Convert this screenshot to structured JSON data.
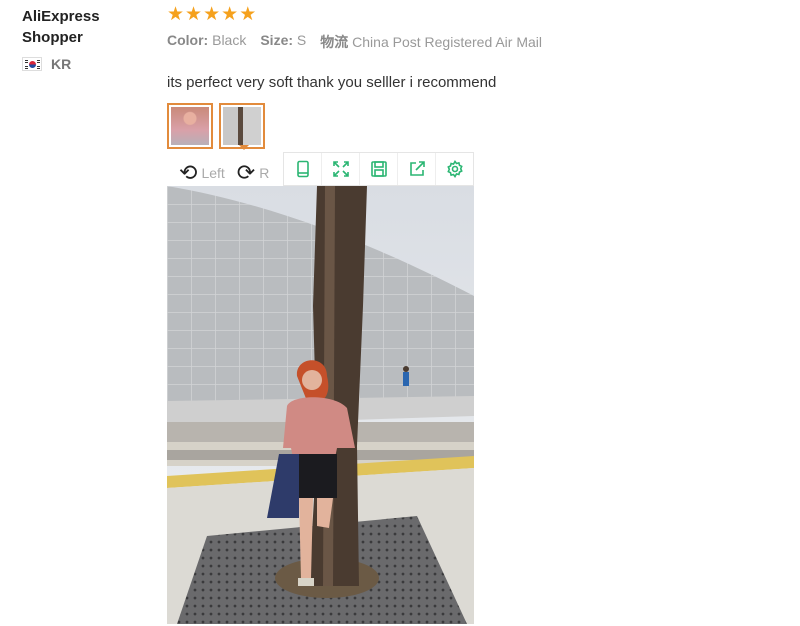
{
  "reviewer": {
    "name": "AliExpress Shopper",
    "country_code": "KR",
    "flag_icon": "south-korea-flag-icon"
  },
  "review": {
    "rating": 5,
    "stars": [
      "★",
      "★",
      "★",
      "★",
      "★"
    ],
    "color_label": "Color:",
    "color_value": "Black",
    "size_label": "Size:",
    "size_value": "S",
    "shipping_label": "物流",
    "shipping_value": "China Post Registered Air Mail",
    "text": "its perfect very soft thank you selller i recommend"
  },
  "photo_viewer": {
    "thumbnails": [
      {
        "name": "photo-thumbnail-1",
        "selected": false
      },
      {
        "name": "photo-thumbnail-2",
        "selected": true
      }
    ],
    "rotate_left_label": "Left",
    "rotate_right_label": "R",
    "toolbar_icons": [
      "mobile-icon",
      "fullscreen-icon",
      "save-icon",
      "share-icon",
      "settings-icon"
    ]
  },
  "colors": {
    "star": "#f5a11d",
    "thumb_border": "#e28b3c",
    "toolbar_icon": "#2bb673"
  }
}
